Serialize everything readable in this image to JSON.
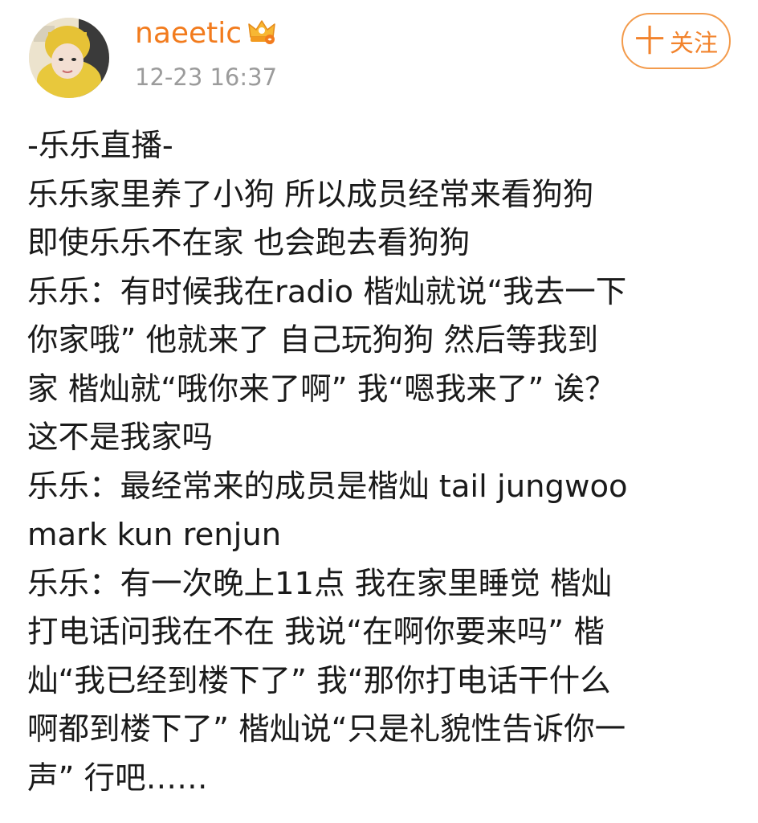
{
  "post": {
    "username": "naeetic",
    "timestamp": "12-23 16:37",
    "follow_button": {
      "plus": "十",
      "label": "关注"
    },
    "lines": [
      "-乐乐直播-",
      "乐乐家里养了小狗 所以成员经常来看狗狗",
      "即使乐乐不在家 也会跑去看狗狗",
      "乐乐：有时候我在radio 楷灿就说“我去一下",
      "你家哦” 他就来了 自己玩狗狗 然后等我到",
      "家 楷灿就“哦你来了啊” 我“嗯我来了” 诶？",
      "这不是我家吗",
      "乐乐：最经常来的成员是楷灿 tail jungwoo",
      "mark kun renjun",
      "乐乐：有一次晚上11点 我在家里睡觉 楷灿",
      "打电话问我在不在 我说“在啊你要来吗” 楷",
      "灿“我已经到楼下了” 我“那你打电话干什么",
      "啊都到楼下了” 楷灿说“只是礼貌性告诉你一",
      "声” 行吧……"
    ]
  },
  "colors": {
    "username": "#f27b1d",
    "timestamp": "#9b9b9b",
    "follow_border": "#f39b4c",
    "text": "#1a1a1a"
  },
  "icons": {
    "avatar": "avatar",
    "badge": "crown-icon"
  }
}
